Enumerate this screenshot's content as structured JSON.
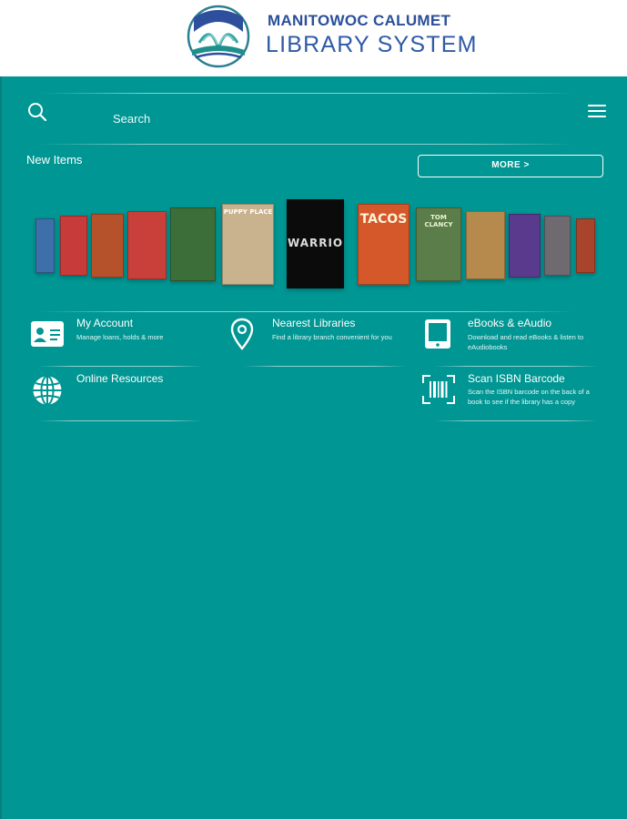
{
  "brand": {
    "line1": "MANITOWOC CALUMET",
    "line2": "LIBRARY SYSTEM"
  },
  "toolbar": {
    "search_label": "Search",
    "search_icon": "search-icon",
    "menu_icon": "hamburger-menu-icon"
  },
  "new_items": {
    "title": "New Items",
    "more_label": "MORE >",
    "covers": [
      {
        "title": "",
        "color": "#3d6fa8"
      },
      {
        "title": "",
        "color": "#c83b3b"
      },
      {
        "title": "",
        "color": "#b5522b"
      },
      {
        "title": "",
        "color": "#c9403a"
      },
      {
        "title": "",
        "color": "#3c6e3a"
      },
      {
        "title": "PUPPY PLACE",
        "color": "#c9b38f"
      },
      {
        "title": "WARRIORS",
        "color": "#0b0b0b"
      },
      {
        "title": "TACOS",
        "color": "#d4582a"
      },
      {
        "title": "TOM CLANCY",
        "color": "#5b7d4a"
      },
      {
        "title": "",
        "color": "#b58a4c"
      },
      {
        "title": "",
        "color": "#5a3a8c"
      },
      {
        "title": "",
        "color": "#6f6a70"
      },
      {
        "title": "",
        "color": "#a8442c"
      }
    ]
  },
  "tiles": [
    {
      "title": "My Account",
      "desc": "Manage loans, holds & more",
      "icon": "account-card-icon"
    },
    {
      "title": "Nearest Libraries",
      "desc": "Find a library branch convenient for you",
      "icon": "location-pin-icon"
    },
    {
      "title": "eBooks & eAudio",
      "desc": "Download and read eBooks & listen to eAudiobooks",
      "icon": "tablet-icon"
    },
    {
      "title": "Online Resources",
      "desc": "",
      "icon": "globe-icon"
    },
    {
      "title": "Scan ISBN Barcode",
      "desc": "Scan the ISBN barcode on the back of a book to see if the library has a copy",
      "icon": "barcode-scan-icon"
    }
  ],
  "colors": {
    "background": "#009693",
    "brand_blue": "#2b4f9a"
  }
}
